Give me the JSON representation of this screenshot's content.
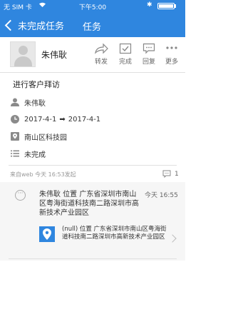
{
  "status_bar": {
    "carrier": "无 SIM 卡",
    "time": "下午5:00"
  },
  "nav": {
    "back_label": "未完成任务",
    "title": "任务"
  },
  "header": {
    "owner_name": "朱伟耿",
    "actions": [
      {
        "label": "转发",
        "icon": "forward-icon"
      },
      {
        "label": "完成",
        "icon": "check-icon"
      },
      {
        "label": "回复",
        "icon": "reply-icon"
      },
      {
        "label": "更多",
        "icon": "more-icon"
      }
    ]
  },
  "task": {
    "title": "进行客户拜访",
    "assignee": "朱伟耿",
    "start_date": "2017-4-1",
    "arrow": "➡",
    "end_date": "2017-4-1",
    "location": "南山区科技园",
    "status": "未完成"
  },
  "meta": {
    "source_line": "来自web   今天 16:53发起",
    "comment_count": "1"
  },
  "feed": {
    "text": "朱伟耿 位置 广东省深圳市南山区粤海街道科技南二路深圳市高新技术产业园区",
    "time": "今天 16:55",
    "location_card": "(null) 位置 广东省深圳市南山区粤海街道科技南二路深圳市高新技术产业园区"
  },
  "colors": {
    "accent": "#2f86df"
  }
}
